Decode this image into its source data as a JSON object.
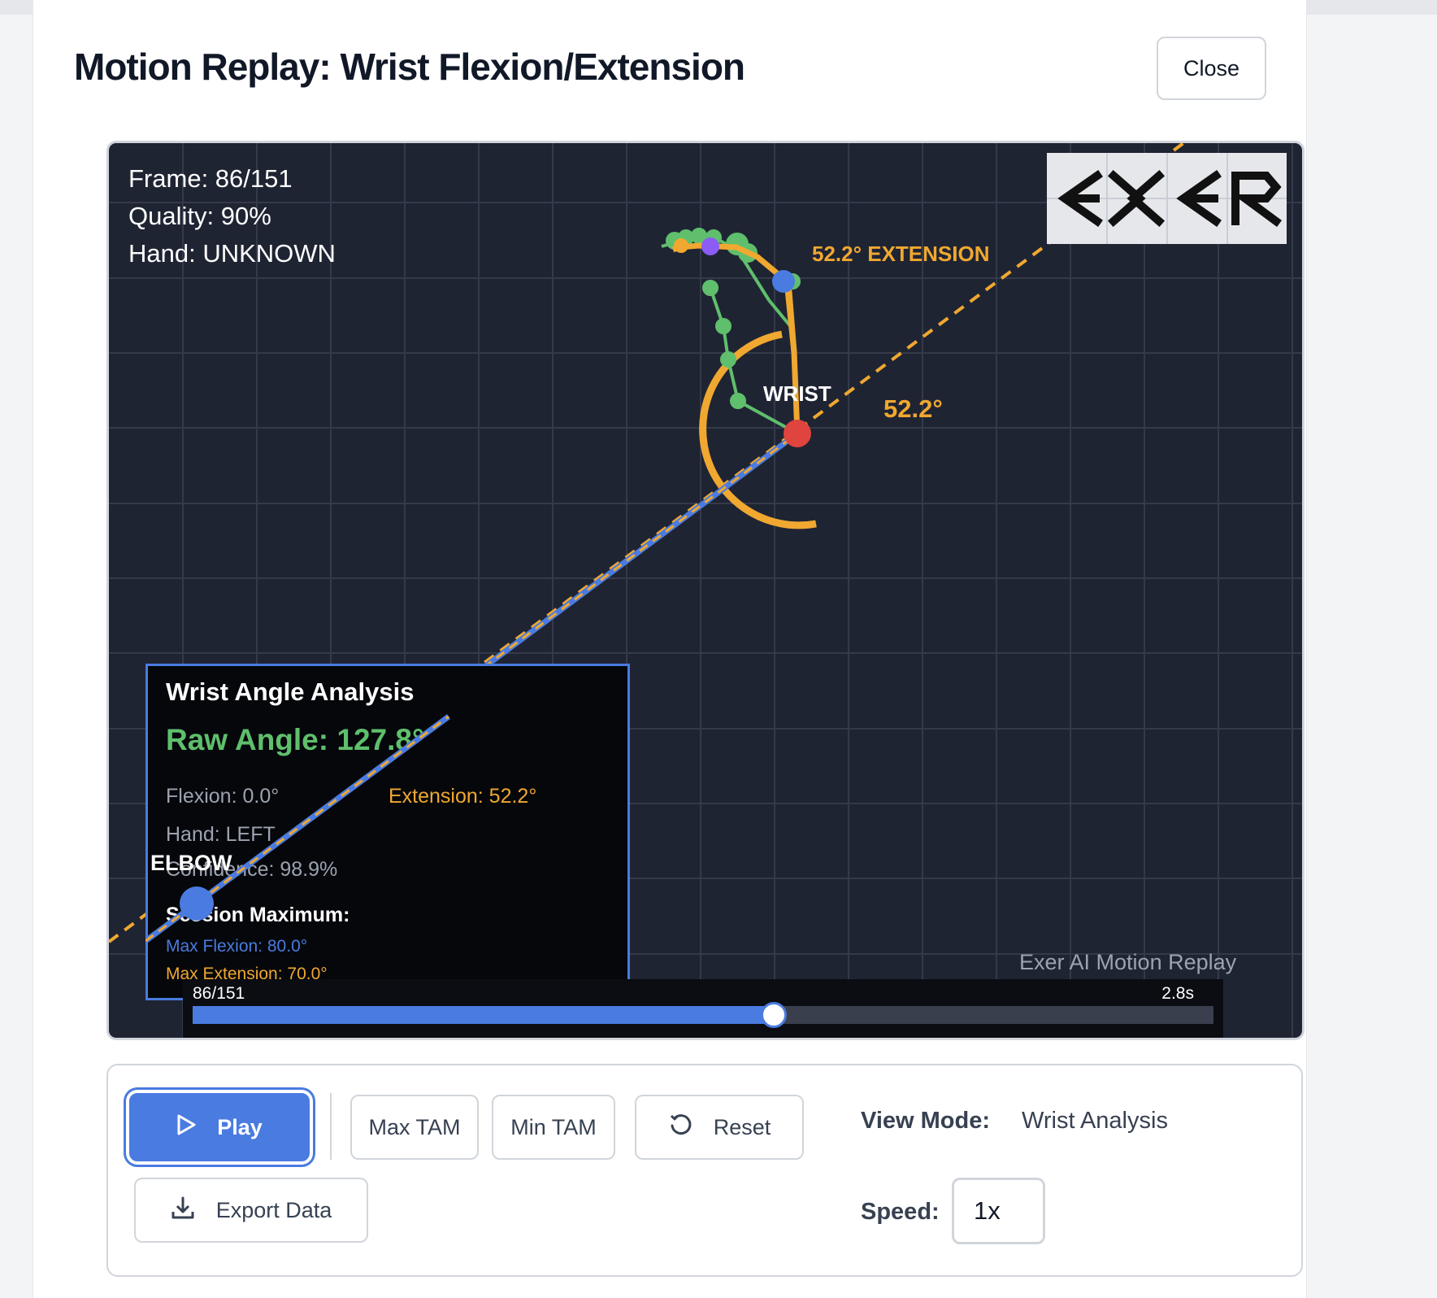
{
  "header": {
    "title": "Motion Replay: Wrist Flexion/Extension",
    "close_label": "Close"
  },
  "overlay": {
    "frame": "Frame: 86/151",
    "quality": "Quality: 90%",
    "hand": "Hand: UNKNOWN"
  },
  "logo": {
    "text": "EXER"
  },
  "scene": {
    "extension_label": "52.2° EXTENSION",
    "angle_label": "52.2°",
    "wrist_label": "WRIST",
    "elbow_label": "ELBOW"
  },
  "analysis": {
    "title": "Wrist Angle Analysis",
    "raw_angle": "Raw Angle: 127.8°",
    "flexion": "Flexion: 0.0°",
    "extension": "Extension: 52.2°",
    "hand": "Hand: LEFT",
    "confidence": "Confidence: 98.9%",
    "session_title": "Session Maximum:",
    "max_flexion": "Max Flexion: 80.0°",
    "max_extension": "Max Extension: 70.0°"
  },
  "watermark": "Exer AI Motion Replay",
  "timeline": {
    "frame_label": "86/151",
    "time_label": "2.8s",
    "progress": 0.567
  },
  "controls": {
    "play_label": "Play",
    "max_tam_label": "Max TAM",
    "min_tam_label": "Min TAM",
    "reset_label": "Reset",
    "export_label": "Export Data",
    "view_mode_label": "View Mode:",
    "view_mode_value": "Wrist Analysis",
    "speed_label": "Speed:",
    "speed_value": "1x"
  },
  "colors": {
    "accent": "#4a7be0",
    "orange": "#f0a830",
    "green": "#5fbf6c",
    "wrist_joint": "#e0443f",
    "canvas_bg": "#1f2433"
  }
}
